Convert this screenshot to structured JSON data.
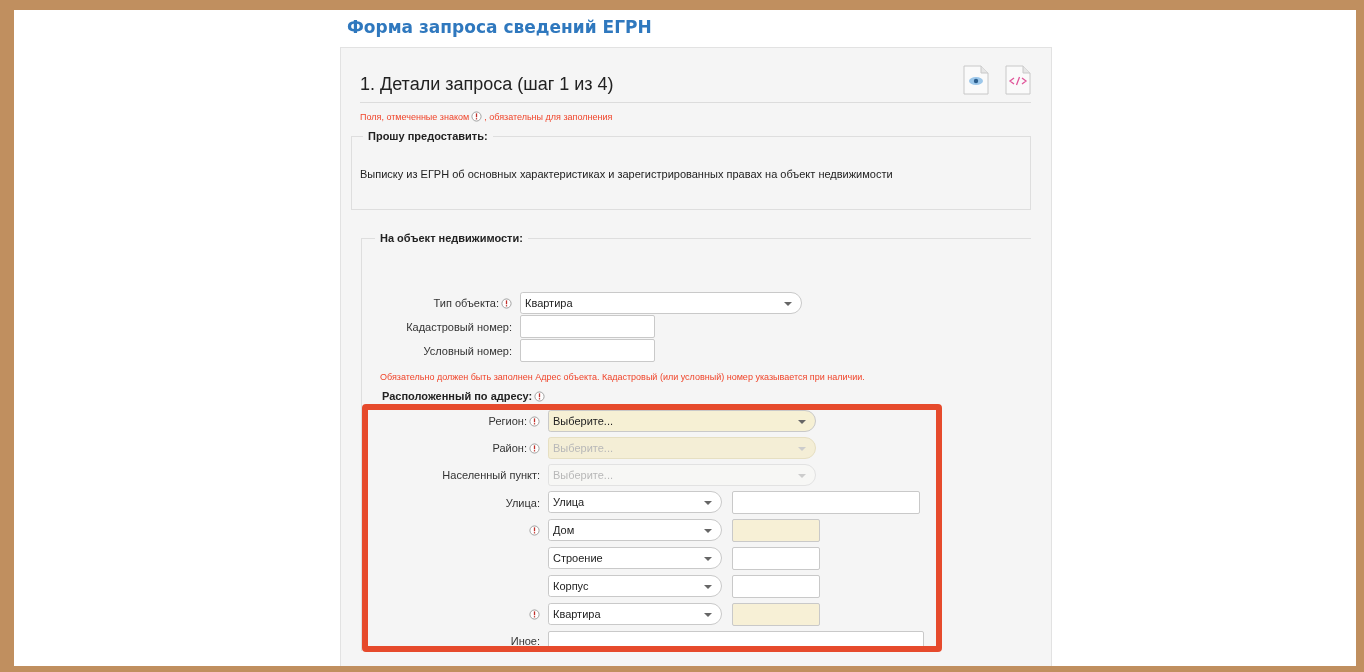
{
  "title": "Форма запроса сведений ЕГРН",
  "step_title": "1. Детали запроса (шаг 1 из 4)",
  "required_note": {
    "before": "Поля, отмеченные знаком",
    "after": ", обязательны для заполнения"
  },
  "request": {
    "legend": "Прошу предоставить:",
    "text": "Выписку из ЕГРН об основных характеристиках и зарегистрированных правах на объект недвижимости"
  },
  "object": {
    "legend": "На объект недвижимости:",
    "fields": [
      {
        "label": "Тип объекта:",
        "required": true,
        "kind": "select",
        "value": "Квартира"
      },
      {
        "label": "Кадастровый номер:",
        "required": false,
        "kind": "input"
      },
      {
        "label": "Условный номер:",
        "required": false,
        "kind": "input"
      }
    ],
    "note": "Обязательно должен быть заполнен Адрес объекта. Кадастровый (или условный) номер указывается при наличии."
  },
  "address": {
    "legend": "Расположенный по адресу:",
    "required": true,
    "selects": [
      {
        "label": "Регион:",
        "required": true,
        "value": "Выберите...",
        "highlighted": true,
        "disabled": false
      },
      {
        "label": "Район:",
        "required": true,
        "value": "Выберите...",
        "highlighted": true,
        "disabled": true
      },
      {
        "label": "Населенный пункт:",
        "required": false,
        "value": "Выберите...",
        "highlighted": false,
        "disabled": true
      }
    ],
    "parts": [
      {
        "label": "Улица:",
        "required": false,
        "value": "Улица",
        "kind": "wide",
        "input_highlighted": false
      },
      {
        "required": true,
        "value": "Дом",
        "kind": "short",
        "input_highlighted": true
      },
      {
        "required": false,
        "value": "Строение",
        "kind": "short",
        "input_highlighted": false
      },
      {
        "required": false,
        "value": "Корпус",
        "kind": "short",
        "input_highlighted": false
      },
      {
        "required": true,
        "value": "Квартира",
        "kind": "short",
        "input_highlighted": true
      }
    ],
    "other": {
      "label": "Иное:"
    }
  }
}
